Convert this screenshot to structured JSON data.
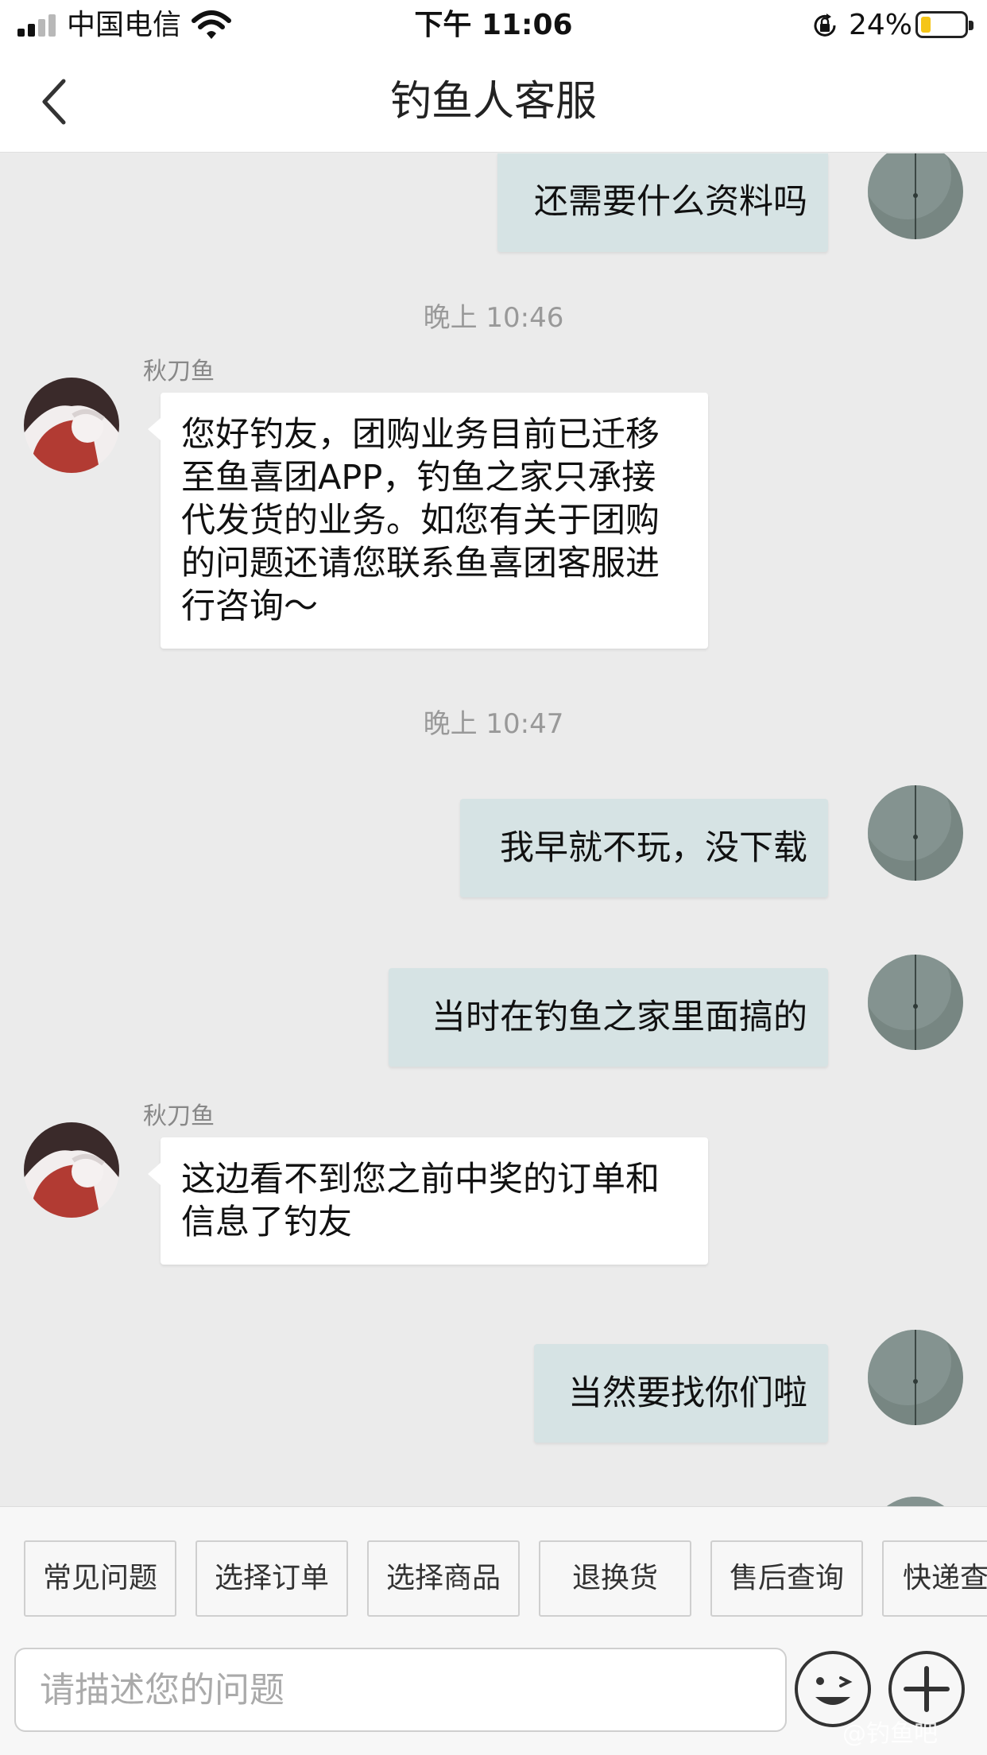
{
  "status_bar": {
    "carrier": "中国电信",
    "time": "下午 11:06",
    "battery_percent": "24%",
    "battery_level": 0.24,
    "icons": [
      "signal-icon",
      "wifi-icon",
      "orientation-lock-icon",
      "battery-icon"
    ]
  },
  "nav": {
    "title": "钓鱼人客服",
    "back_icon": "chevron-left-icon"
  },
  "chat": {
    "messages": [
      {
        "side": "right",
        "text": "还需要什么资料吗"
      },
      {
        "type": "timestamp",
        "text": "晚上 10:46"
      },
      {
        "side": "left",
        "sender": "秋刀鱼",
        "text": "您好钓友，团购业务目前已迁移至鱼喜团APP，钓鱼之家只承接代发货的业务。如您有关于团购的问题还请您联系鱼喜团客服进行咨询～"
      },
      {
        "type": "timestamp",
        "text": "晚上 10:47"
      },
      {
        "side": "right",
        "text": "我早就不玩，没下载"
      },
      {
        "side": "right",
        "text": "当时在钓鱼之家里面搞的"
      },
      {
        "side": "left",
        "sender": "秋刀鱼",
        "text": "这边看不到您之前中奖的订单和信息了钓友"
      },
      {
        "side": "right",
        "text": "当然要找你们啦"
      }
    ]
  },
  "quick_replies": [
    "常见问题",
    "选择订单",
    "选择商品",
    "退换货",
    "售后查询",
    "快递查"
  ],
  "input": {
    "placeholder": "请描述您的问题",
    "emoji_icon": "emoji-icon",
    "plus_icon": "plus-icon"
  },
  "watermark": "@钓鱼吧"
}
